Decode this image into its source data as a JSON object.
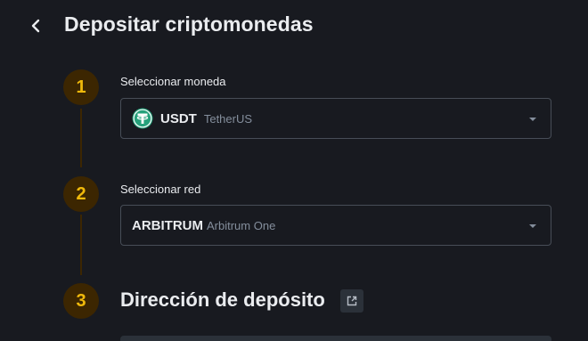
{
  "header": {
    "title": "Depositar criptomonedas",
    "back_icon": "chevron-left-icon"
  },
  "steps": [
    {
      "number": "1",
      "label": "Seleccionar moneda",
      "select": {
        "symbol": "USDT",
        "name": "TetherUS",
        "icon": "tether-icon",
        "icon_color": "#26a17b"
      }
    },
    {
      "number": "2",
      "label": "Seleccionar red",
      "select": {
        "symbol": "ARBITRUM",
        "name": "Arbitrum One"
      }
    },
    {
      "number": "3",
      "label": "Dirección de depósito",
      "icon": "external-link-icon"
    }
  ],
  "colors": {
    "background": "#181a20",
    "accent": "#f0b90b",
    "step_circle_bg": "#3c2601",
    "border": "#474d57",
    "muted_text": "#848e9c"
  }
}
